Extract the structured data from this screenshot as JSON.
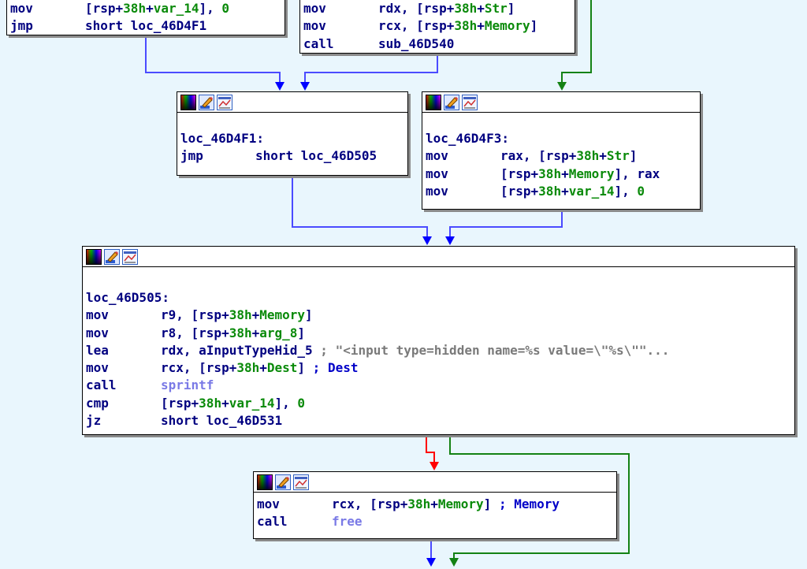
{
  "colors": {
    "background": "#e9f6fd",
    "edge_unconditional": "#4b4bff",
    "edge_true": "#148214",
    "edge_false": "#ff0000",
    "keyword": "#000080",
    "number": "#0a8a0a",
    "comment": "#7a7a7a",
    "import_function": "#7a7ae6"
  },
  "icons": [
    "color-palette-icon",
    "edit-pencil-icon",
    "graph-overview-icon"
  ],
  "blocks": {
    "topLeft": {
      "lines": [
        {
          "m": "mov",
          "ops": [
            [
              "b",
              "[rsp+"
            ],
            [
              "n",
              "38h"
            ],
            [
              "b",
              "+"
            ],
            [
              "n",
              "var_14"
            ],
            [
              "b",
              "], "
            ],
            [
              "n",
              "0"
            ]
          ]
        },
        {
          "m": "jmp",
          "ops": [
            [
              "b",
              "short loc_46D4F1"
            ]
          ]
        }
      ]
    },
    "topRight": {
      "lines": [
        {
          "m": "mov",
          "ops": [
            [
              "b",
              "rdx, [rsp+"
            ],
            [
              "n",
              "38h"
            ],
            [
              "b",
              "+"
            ],
            [
              "n",
              "Str"
            ],
            [
              "b",
              "]"
            ]
          ]
        },
        {
          "m": "mov",
          "ops": [
            [
              "b",
              "rcx, [rsp+"
            ],
            [
              "n",
              "38h"
            ],
            [
              "b",
              "+"
            ],
            [
              "n",
              "Memory"
            ],
            [
              "b",
              "]"
            ]
          ]
        },
        {
          "m": "call",
          "ops": [
            [
              "b",
              "sub_46D540"
            ]
          ]
        }
      ]
    },
    "loc4F1": {
      "label": "loc_46D4F1:",
      "lines": [
        {
          "m": "jmp",
          "ops": [
            [
              "b",
              "short loc_46D505"
            ]
          ]
        }
      ]
    },
    "loc4F3": {
      "label": "loc_46D4F3:",
      "lines": [
        {
          "m": "mov",
          "ops": [
            [
              "b",
              "rax, [rsp+"
            ],
            [
              "n",
              "38h"
            ],
            [
              "b",
              "+"
            ],
            [
              "n",
              "Str"
            ],
            [
              "b",
              "]"
            ]
          ]
        },
        {
          "m": "mov",
          "ops": [
            [
              "b",
              "[rsp+"
            ],
            [
              "n",
              "38h"
            ],
            [
              "b",
              "+"
            ],
            [
              "n",
              "Memory"
            ],
            [
              "b",
              "], rax"
            ]
          ]
        },
        {
          "m": "mov",
          "ops": [
            [
              "b",
              "[rsp+"
            ],
            [
              "n",
              "38h"
            ],
            [
              "b",
              "+"
            ],
            [
              "n",
              "var_14"
            ],
            [
              "b",
              "], "
            ],
            [
              "n",
              "0"
            ]
          ]
        }
      ]
    },
    "loc505": {
      "label": "loc_46D505:",
      "lines": [
        {
          "m": "mov",
          "ops": [
            [
              "b",
              "r9, [rsp+"
            ],
            [
              "n",
              "38h"
            ],
            [
              "b",
              "+"
            ],
            [
              "n",
              "Memory"
            ],
            [
              "b",
              "]"
            ]
          ]
        },
        {
          "m": "mov",
          "ops": [
            [
              "b",
              "r8, [rsp+"
            ],
            [
              "n",
              "38h"
            ],
            [
              "b",
              "+"
            ],
            [
              "n",
              "arg_8"
            ],
            [
              "b",
              "]"
            ]
          ]
        },
        {
          "m": "lea",
          "ops": [
            [
              "b",
              "rdx, aInputTypeHid_5 "
            ],
            [
              "c",
              "; \"<input type=hidden name=%s value=\\\"%s\\\"\"..."
            ]
          ]
        },
        {
          "m": "mov",
          "ops": [
            [
              "b",
              "rcx, [rsp+"
            ],
            [
              "n",
              "38h"
            ],
            [
              "b",
              "+"
            ],
            [
              "n",
              "Dest"
            ],
            [
              "b",
              "] "
            ],
            [
              "s",
              "; Dest"
            ]
          ]
        },
        {
          "m": "call",
          "ops": [
            [
              "f",
              "sprintf"
            ]
          ]
        },
        {
          "m": "cmp",
          "ops": [
            [
              "b",
              "[rsp+"
            ],
            [
              "n",
              "38h"
            ],
            [
              "b",
              "+"
            ],
            [
              "n",
              "var_14"
            ],
            [
              "b",
              "], "
            ],
            [
              "n",
              "0"
            ]
          ]
        },
        {
          "m": "jz",
          "ops": [
            [
              "b",
              "short loc_46D531"
            ]
          ]
        }
      ]
    },
    "freeBlock": {
      "lines": [
        {
          "m": "mov",
          "ops": [
            [
              "b",
              "rcx, [rsp+"
            ],
            [
              "n",
              "38h"
            ],
            [
              "b",
              "+"
            ],
            [
              "n",
              "Memory"
            ],
            [
              "b",
              "] "
            ],
            [
              "s",
              "; Memory"
            ]
          ]
        },
        {
          "m": "call",
          "ops": [
            [
              "f",
              "free"
            ]
          ]
        }
      ]
    }
  }
}
